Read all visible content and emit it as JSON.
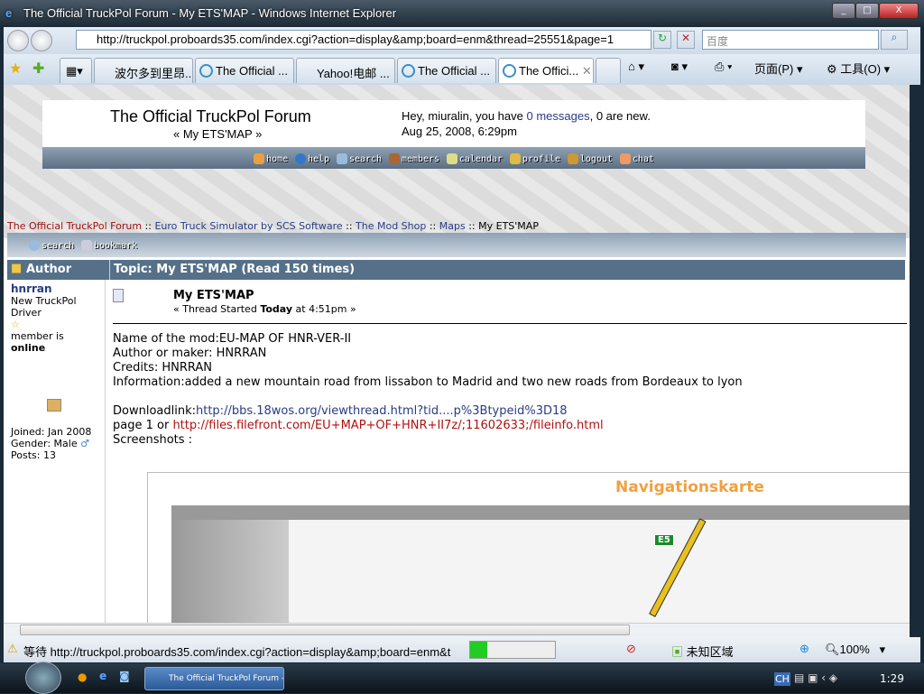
{
  "window": {
    "title": "The Official TruckPol Forum - My ETS'MAP - Windows Internet Explorer"
  },
  "browser": {
    "url": "http://truckpol.proboards35.com/index.cgi?action=display&amp;board=enm&thread=25551&page=1",
    "search_placeholder": "百度",
    "tabs": [
      {
        "label": "波尔多到里昂..."
      },
      {
        "label": "The Official ..."
      },
      {
        "label": "Yahoo!电邮 ..."
      },
      {
        "label": "The Official ..."
      },
      {
        "label": "The Offici..."
      }
    ],
    "toolbar": {
      "page": "页面(P)",
      "tools": "工具(O)"
    }
  },
  "forum": {
    "title": "The Official TruckPol Forum",
    "subtitle": "« My ETS'MAP »",
    "greeting_pre": "Hey, miuralin, you have ",
    "messages": "0 messages",
    "greeting_post": ", 0 are new.",
    "datetime": "Aug 25, 2008, 6:29pm",
    "nav": [
      "home",
      "help",
      "search",
      "members",
      "calendar",
      "profile",
      "logout",
      "chat"
    ],
    "breadcrumb": [
      "The Official TruckPol Forum",
      "Euro Truck Simulator by SCS Software",
      "The Mod Shop",
      "Maps",
      "My ETS'MAP"
    ],
    "actions": [
      "search",
      "bookmark"
    ]
  },
  "thread": {
    "author_header": "Author",
    "topic_header": "Topic: My ETS'MAP (Read 150 times)",
    "author": {
      "name": "hnrran",
      "rank": "New TruckPol Driver",
      "status_pre": "member is",
      "status": "online",
      "joined": "Joined: Jan 2008",
      "gender": "Gender: Male",
      "posts": "Posts: 13"
    },
    "post": {
      "title": "My ETS'MAP",
      "started_pre": "« Thread Started ",
      "started_day": "Today",
      "started_post": " at 4:51pm »",
      "lines": [
        "Name of the mod:EU-MAP OF HNR-VER-II",
        "Author or maker: HNRRAN",
        "Credits: HNRRAN",
        "Information:added a new mountain road from lissabon to Madrid and two new roads from Bordeaux to lyon"
      ],
      "download_label": "Downloadlink:",
      "download_url": "http://bbs.18wos.org/viewthread.html?tid....p%3Btypeid%3D18",
      "page_label": "page 1 or ",
      "page_url": "http://files.filefront.com/EU+MAP+OF+HNR+II7z/;11602633;/fileinfo.html",
      "screenshots": "Screenshots :",
      "image_title": "Navigationskarte",
      "road_label": "E5"
    }
  },
  "status": {
    "text": "等待 http://truckpol.proboards35.com/index.cgi?action=display&amp;board=enm&t",
    "progress_percent": 20,
    "zone": "未知区域",
    "zoom": "100%"
  },
  "taskbar": {
    "window": "The Official TruckPol Forum - ...",
    "lang": "CH",
    "time": "1:29"
  }
}
